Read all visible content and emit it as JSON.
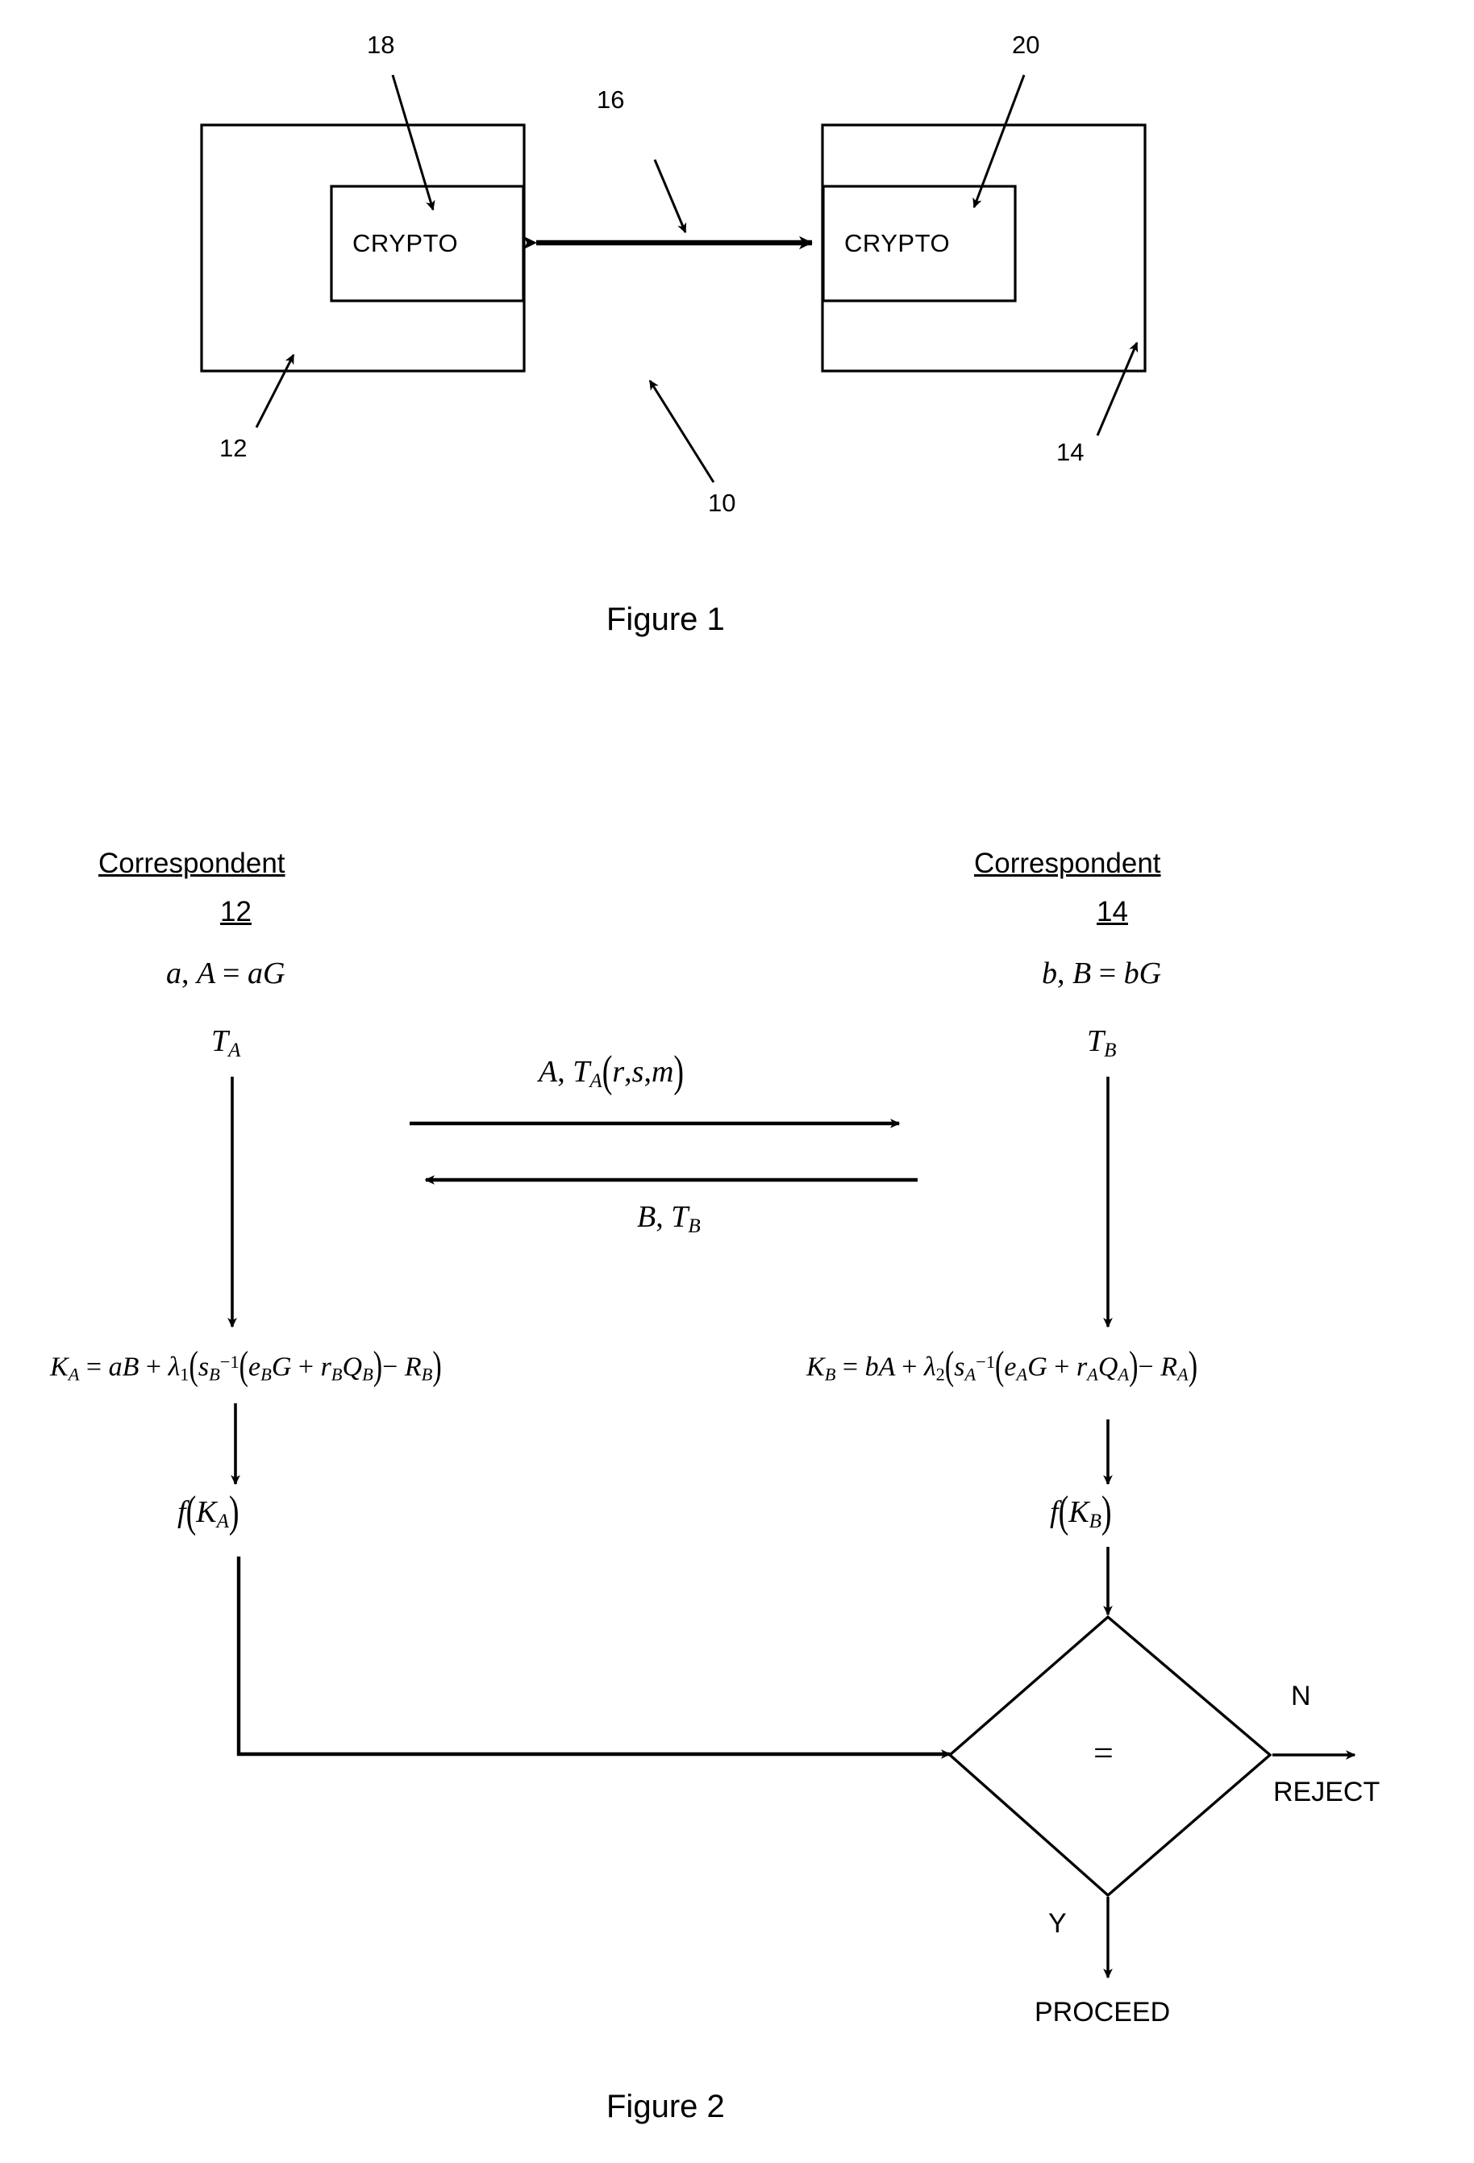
{
  "document": {
    "type": "patent-drawing-sheet",
    "figures": [
      "Figure 1",
      "Figure 2"
    ]
  },
  "figure1": {
    "caption": "Figure 1",
    "left_device": {
      "inner_label": "CRYPTO",
      "inner_ref": "18",
      "outer_ref": "12"
    },
    "right_device": {
      "inner_label": "CRYPTO",
      "inner_ref": "20",
      "outer_ref": "14"
    },
    "channel_ref": "16",
    "system_ref": "10"
  },
  "figure2": {
    "caption": "Figure 2",
    "left_party": {
      "title": "Correspondent",
      "ref": "12",
      "keys": "a, A = aG",
      "ephemeral": "TA",
      "session_key": "KA = aB + λ1(sB⁻¹(eB G + rB QB) − RB)",
      "kdf": "f(KA)"
    },
    "right_party": {
      "title": "Correspondent",
      "ref": "14",
      "keys": "b, B = bG",
      "ephemeral": "TB",
      "session_key": "KB = bA + λ2(sA⁻¹(eA G + rA QA) − RA)",
      "kdf": "f(KB)"
    },
    "messages": [
      {
        "label": "A, TA(r, s, m)",
        "direction": "left-to-right"
      },
      {
        "label": "B, TB",
        "direction": "right-to-left"
      }
    ],
    "decision": {
      "symbol": "=",
      "yes_label": "Y",
      "no_label": "N",
      "yes_outcome": "PROCEED",
      "no_outcome": "REJECT"
    }
  },
  "style": {
    "ink": "#000000",
    "paper": "#ffffff"
  }
}
